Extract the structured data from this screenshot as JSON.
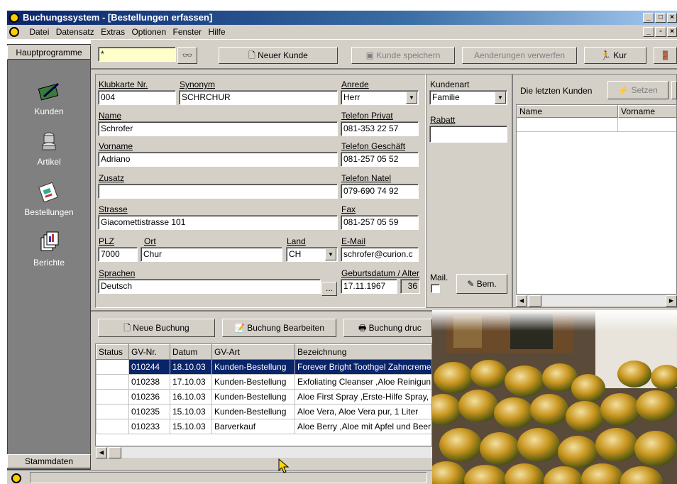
{
  "window": {
    "title": "Buchungssystem - [Bestellungen erfassen]"
  },
  "menu": [
    "Datei",
    "Datensatz",
    "Extras",
    "Optionen",
    "Fenster",
    "Hilfe"
  ],
  "sidebar": {
    "header": "Hauptprogramme",
    "footer": "Stammdaten",
    "items": [
      {
        "label": "Kunden",
        "icon": "kunden-icon"
      },
      {
        "label": "Artikel",
        "icon": "artikel-icon"
      },
      {
        "label": "Bestellungen",
        "icon": "bestellungen-icon"
      },
      {
        "label": "Berichte",
        "icon": "berichte-icon"
      }
    ]
  },
  "toolbar": {
    "search_value": "*",
    "new_customer": "Neuer Kunde",
    "save_customer": "Kunde speichern",
    "discard_changes": "Aenderungen verwerfen",
    "kur": "Kur"
  },
  "customer": {
    "klubkarte_label": "Klubkarte Nr.",
    "klubkarte": "004",
    "synonym_label": "Synonym",
    "synonym": "SCHRCHUR",
    "anrede_label": "Anrede",
    "anrede": "Herr",
    "kundenart_label": "Kundenart",
    "kundenart": "Familie",
    "name_label": "Name",
    "name": "Schrofer",
    "tel_privat_label": "Telefon Privat",
    "tel_privat": "081-353 22 57",
    "rabatt_label": "Rabatt",
    "rabatt": "",
    "vorname_label": "Vorname",
    "vorname": "Adriano",
    "tel_geschaeft_label": "Telefon Geschäft",
    "tel_geschaeft": "081-257 05 52",
    "zusatz_label": "Zusatz",
    "zusatz": "",
    "tel_natel_label": "Telefon Natel",
    "tel_natel": "079-690 74 92",
    "strasse_label": "Strasse",
    "strasse": "Giacomettistrasse 101",
    "fax_label": "Fax",
    "fax": "081-257 05 59",
    "plz_label": "PLZ",
    "plz": "7000",
    "ort_label": "Ort",
    "ort": "Chur",
    "land_label": "Land",
    "land": "CH",
    "email_label": "E-Mail",
    "email": "schrofer@curion.c",
    "sprachen_label": "Sprachen",
    "sprachen": "Deutsch",
    "geburtsdatum_label": "Geburtsdatum / Alter",
    "geburtsdatum": "17.11.1967",
    "alter": "36",
    "mail_label": "Mail.",
    "bem_button": "Bem.",
    "ellipsis": "..."
  },
  "recent": {
    "label": "Die letzten Kunden",
    "set_button": "Setzen",
    "col_name": "Name",
    "col_vorname": "Vorname"
  },
  "bookings": {
    "new_booking": "Neue Buchung",
    "edit_booking": "Buchung Bearbeiten",
    "print_booking": "Buchung druc",
    "columns": [
      "Status",
      "GV-Nr.",
      "Datum",
      "GV-Art",
      "Bezeichnung"
    ],
    "rows": [
      {
        "status": "",
        "nr": "010244",
        "datum": "18.10.03",
        "art": "Kunden-Bestellung",
        "bez": "Forever Bright Toothgel Zahncreme"
      },
      {
        "status": "",
        "nr": "010238",
        "datum": "17.10.03",
        "art": "Kunden-Bestellung",
        "bez": "Exfoliating Cleanser ,Aloe Reinigun"
      },
      {
        "status": "",
        "nr": "010236",
        "datum": "16.10.03",
        "art": "Kunden-Bestellung",
        "bez": "Aloe First Spray ,Erste-Hilfe Spray,"
      },
      {
        "status": "",
        "nr": "010235",
        "datum": "15.10.03",
        "art": "Kunden-Bestellung",
        "bez": "Aloe Vera, Aloe Vera pur, 1 Liter"
      },
      {
        "status": "",
        "nr": "010233",
        "datum": "15.10.03",
        "art": "Barverkauf",
        "bez": "Aloe Berry ,Aloe mit Apfel und Beer"
      }
    ]
  },
  "colors": {
    "titlebar": "#0a246a",
    "face": "#d4d0c8",
    "sidebar": "#808080",
    "selection": "#0a246a"
  }
}
